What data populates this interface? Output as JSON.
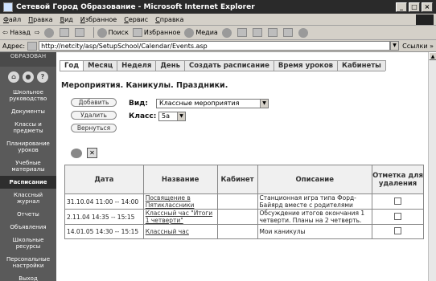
{
  "window": {
    "title": "Сетевой Город Образование - Microsoft Internet Explorer",
    "buttons": [
      "_",
      "□",
      "×"
    ]
  },
  "menubar": {
    "items": [
      {
        "u": "Ф",
        "rest": "айл"
      },
      {
        "u": "П",
        "rest": "равка"
      },
      {
        "u": "В",
        "rest": "ид"
      },
      {
        "u": "И",
        "rest": "збранное"
      },
      {
        "u": "С",
        "rest": "ервис"
      },
      {
        "u": "С",
        "rest": "правка"
      }
    ]
  },
  "toolbar": {
    "back": "Назад",
    "search": "Поиск",
    "favorites": "Избранное",
    "media": "Медиа"
  },
  "addressbar": {
    "label": "Адрес:",
    "url": "http://netcity/asp/SetupSchool/Calendar/Events.asp",
    "links": "Ссылки"
  },
  "sidebar": {
    "logo": "ОБРАЗОВАН",
    "icon_help": "?",
    "items": [
      {
        "label": "Школьное руководство",
        "active": false
      },
      {
        "label": "Документы",
        "active": false
      },
      {
        "label": "Классы и предметы",
        "active": false
      },
      {
        "label": "Планирование уроков",
        "active": false
      },
      {
        "label": "Учебные материалы",
        "active": false
      },
      {
        "label": "Расписание",
        "active": true
      },
      {
        "label": "Классный журнал",
        "active": false
      },
      {
        "label": "Отчеты",
        "active": false
      },
      {
        "label": "Объявления",
        "active": false
      },
      {
        "label": "Школьные ресурсы",
        "active": false
      },
      {
        "label": "Персональные настройки",
        "active": false
      },
      {
        "label": "Выход",
        "active": false
      }
    ]
  },
  "tabs": [
    "Год",
    "Месяц",
    "Неделя",
    "День",
    "Создать расписание",
    "Время уроков",
    "Кабинеты"
  ],
  "heading": "Мероприятия. Каникулы. Праздники.",
  "buttons": {
    "add": "Добавить",
    "delete": "Удалить",
    "back": "Вернуться"
  },
  "filters": {
    "type_label": "Вид:",
    "type_value": "Классные мероприятия",
    "class_label": "Класс:",
    "class_value": "5а"
  },
  "table": {
    "headers": [
      "Дата",
      "Название",
      "Кабинет",
      "Описание",
      "Отметка для удаления"
    ],
    "rows": [
      {
        "date": "31.10.04 11:00 -- 14:00",
        "title": "Посвящение в Пятиклассники",
        "room": "",
        "description": "Станционная игра типа Форд-Байярд вместе с родителями"
      },
      {
        "date": "2.11.04 14:35 -- 15:15",
        "title": "Классный час \"Итоги 1 четверти\"",
        "room": "",
        "description": "Обсуждение итогов окончания 1 четверти. Планы на 2 четверть."
      },
      {
        "date": "14.01.05 14:30 -- 15:15",
        "title": "Классный час",
        "room": "",
        "description": "Мои каникулы"
      }
    ]
  }
}
